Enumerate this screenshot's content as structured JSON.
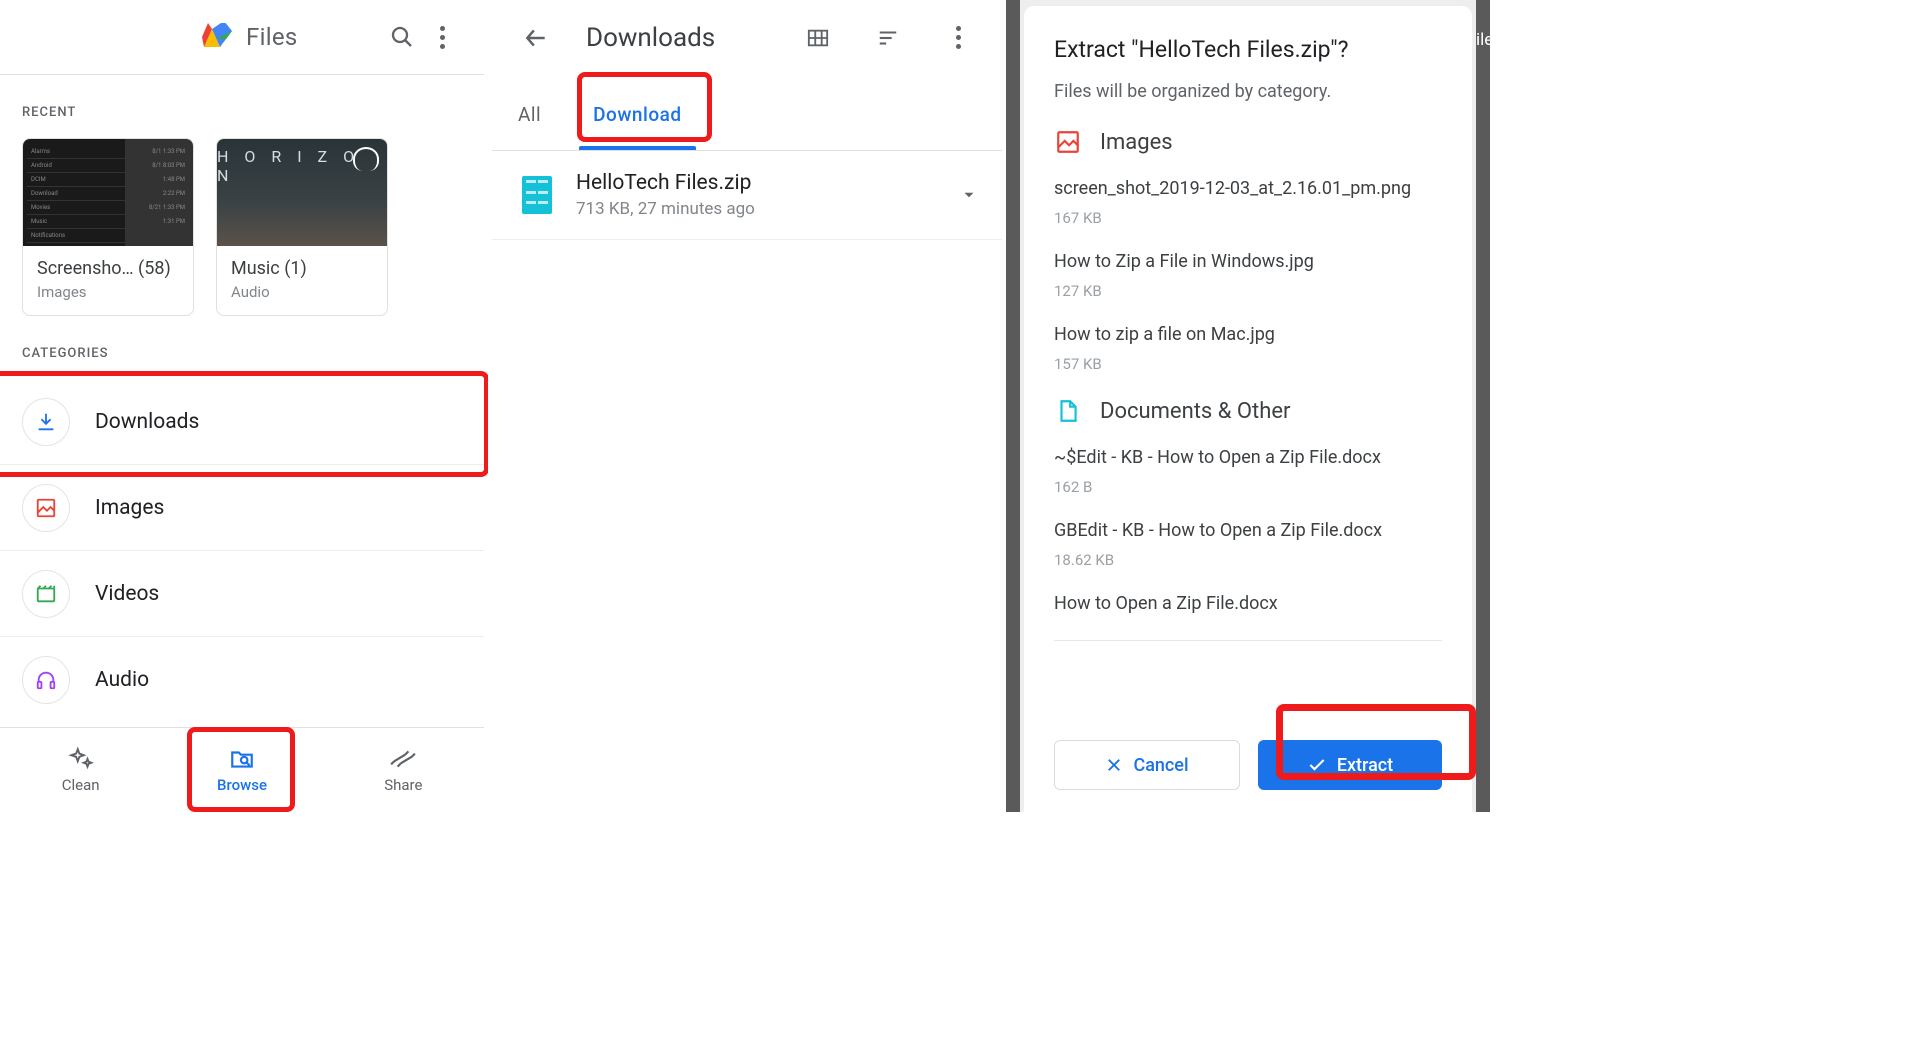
{
  "screen1": {
    "app_title": "Files",
    "recent_label": "RECENT",
    "categories_label": "CATEGORIES",
    "recent_cards": [
      {
        "title": "Screensho… (58)",
        "subtitle": "Images"
      },
      {
        "title": "Music (1)",
        "subtitle": "Audio"
      }
    ],
    "horizon_text": "H O R I Z O N",
    "categories": [
      {
        "label": "Downloads"
      },
      {
        "label": "Images"
      },
      {
        "label": "Videos"
      },
      {
        "label": "Audio"
      }
    ],
    "nav": [
      {
        "label": "Clean"
      },
      {
        "label": "Browse"
      },
      {
        "label": "Share"
      }
    ]
  },
  "screen2": {
    "title": "Downloads",
    "tabs": [
      {
        "label": "All"
      },
      {
        "label": "Download"
      }
    ],
    "file": {
      "name": "HelloTech Files.zip",
      "meta": "713 KB, 27 minutes ago"
    }
  },
  "screen3": {
    "title": "Extract \"HelloTech Files.zip\"?",
    "subtitle": "Files will be organized by category.",
    "sections": [
      {
        "label": "Images",
        "files": [
          {
            "name": "screen_shot_2019-12-03_at_2.16.01_pm.png",
            "size": "167 KB"
          },
          {
            "name": "How to Zip a File in Windows.jpg",
            "size": "127 KB"
          },
          {
            "name": "How to zip a file on Mac.jpg",
            "size": "157 KB"
          }
        ]
      },
      {
        "label": "Documents & Other",
        "files": [
          {
            "name": "~$Edit - KB - How to Open a Zip File.docx",
            "size": "162 B"
          },
          {
            "name": "GBEdit - KB - How to Open a Zip File.docx",
            "size": "18.62 KB"
          },
          {
            "name": "How to Open a Zip File.docx",
            "size": ""
          }
        ]
      }
    ],
    "cancel_label": "Cancel",
    "extract_label": "Extract",
    "edge_text": "ile"
  }
}
